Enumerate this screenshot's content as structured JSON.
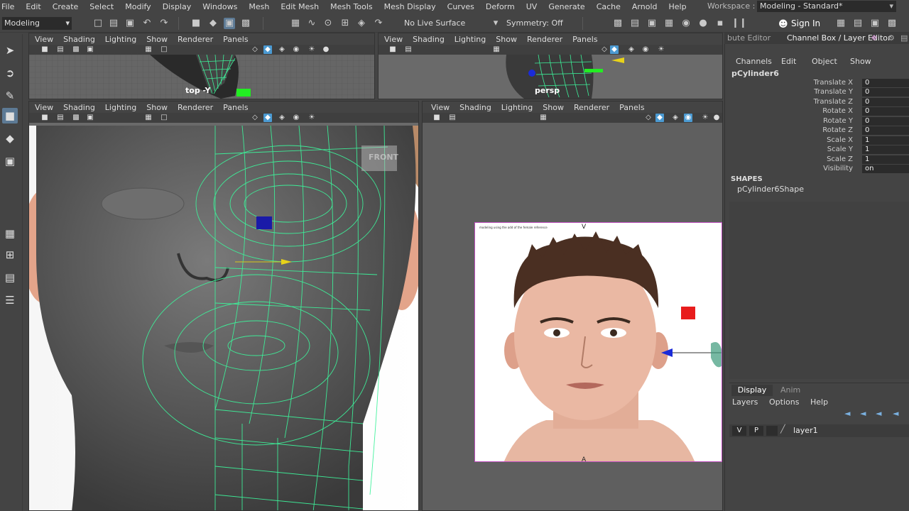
{
  "menubar": {
    "items": [
      "File",
      "Edit",
      "Create",
      "Select",
      "Modify",
      "Display",
      "Windows",
      "Mesh",
      "Edit Mesh",
      "Mesh Tools",
      "Mesh Display",
      "Curves",
      "Deform",
      "UV",
      "Generate",
      "Cache",
      "Arnold",
      "Help"
    ],
    "workspace_label": "Workspace :",
    "workspace_value": "Modeling - Standard*"
  },
  "statusline": {
    "mode": "Modeling",
    "live_surface": "No Live Surface",
    "symmetry": "Symmetry: Off",
    "sign_in": "Sign In"
  },
  "viewports": {
    "menu": [
      "View",
      "Shading",
      "Lighting",
      "Show",
      "Renderer",
      "Panels"
    ],
    "top_label": "top -Y",
    "persp_label": "persp",
    "front_label": "FRONT"
  },
  "reference_image": {
    "caption": "modeling using the add of the female reference"
  },
  "channel_box": {
    "tab_attribute": "bute Editor",
    "tab_channel": "Channel Box / Layer Editor",
    "menu": [
      "Channels",
      "Edit",
      "Object",
      "Show"
    ],
    "object_name": "pCylinder6",
    "attributes": [
      {
        "name": "Translate X",
        "value": "0"
      },
      {
        "name": "Translate Y",
        "value": "0"
      },
      {
        "name": "Translate Z",
        "value": "0"
      },
      {
        "name": "Rotate X",
        "value": "0"
      },
      {
        "name": "Rotate Y",
        "value": "0"
      },
      {
        "name": "Rotate Z",
        "value": "0"
      },
      {
        "name": "Scale X",
        "value": "1"
      },
      {
        "name": "Scale Y",
        "value": "1"
      },
      {
        "name": "Scale Z",
        "value": "1"
      },
      {
        "name": "Visibility",
        "value": "on"
      }
    ],
    "shapes_title": "SHAPES",
    "shape_name": "pCylinder6Shape"
  },
  "layer_editor": {
    "tab_display": "Display",
    "tab_anim": "Anim",
    "menu": [
      "Layers",
      "Options",
      "Help"
    ],
    "layer": {
      "v": "V",
      "p": "P",
      "name": "layer1"
    }
  },
  "colors": {
    "accent": "#5d7a95",
    "wireframe": "#3df29a",
    "ui_bg": "#444444"
  }
}
